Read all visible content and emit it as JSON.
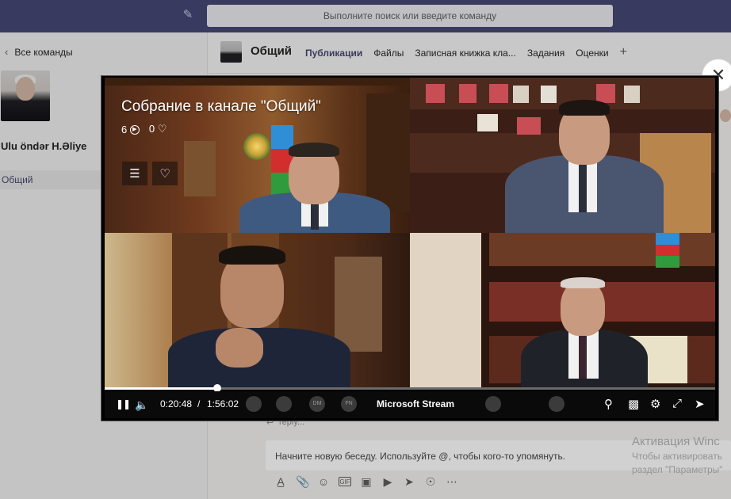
{
  "topbar": {
    "search_placeholder": "Выполните поиск или введите команду",
    "compose_icon": "compose-icon"
  },
  "left": {
    "back_label": "Все команды",
    "team_name": "Ulu öndər H.Əliye",
    "channel": "Общий"
  },
  "channel_header": {
    "title": "Общий",
    "tabs": [
      "Публикации",
      "Файлы",
      "Записная книжка кла...",
      "Задания",
      "Оценки"
    ],
    "active_tab": 0,
    "add_tab": "+"
  },
  "video": {
    "title": "Собрание в канале \"Общий\"",
    "views": "6",
    "likes": "0",
    "current_time": "0:20:48",
    "separator": "/",
    "duration": "1:56:02",
    "brand": "Microsoft Stream",
    "progress": 0.184,
    "participants": [
      "DM",
      "FN"
    ],
    "close_icon": "close-icon"
  },
  "chat": {
    "reply_stub": "reply...",
    "compose_placeholder": "Начните новую беседу. Используйте @, чтобы кого-то упомянуть."
  },
  "activation": {
    "line1": "Активация Winc",
    "line2": "Чтобы активировать",
    "line3": "раздел \"Параметры\""
  }
}
